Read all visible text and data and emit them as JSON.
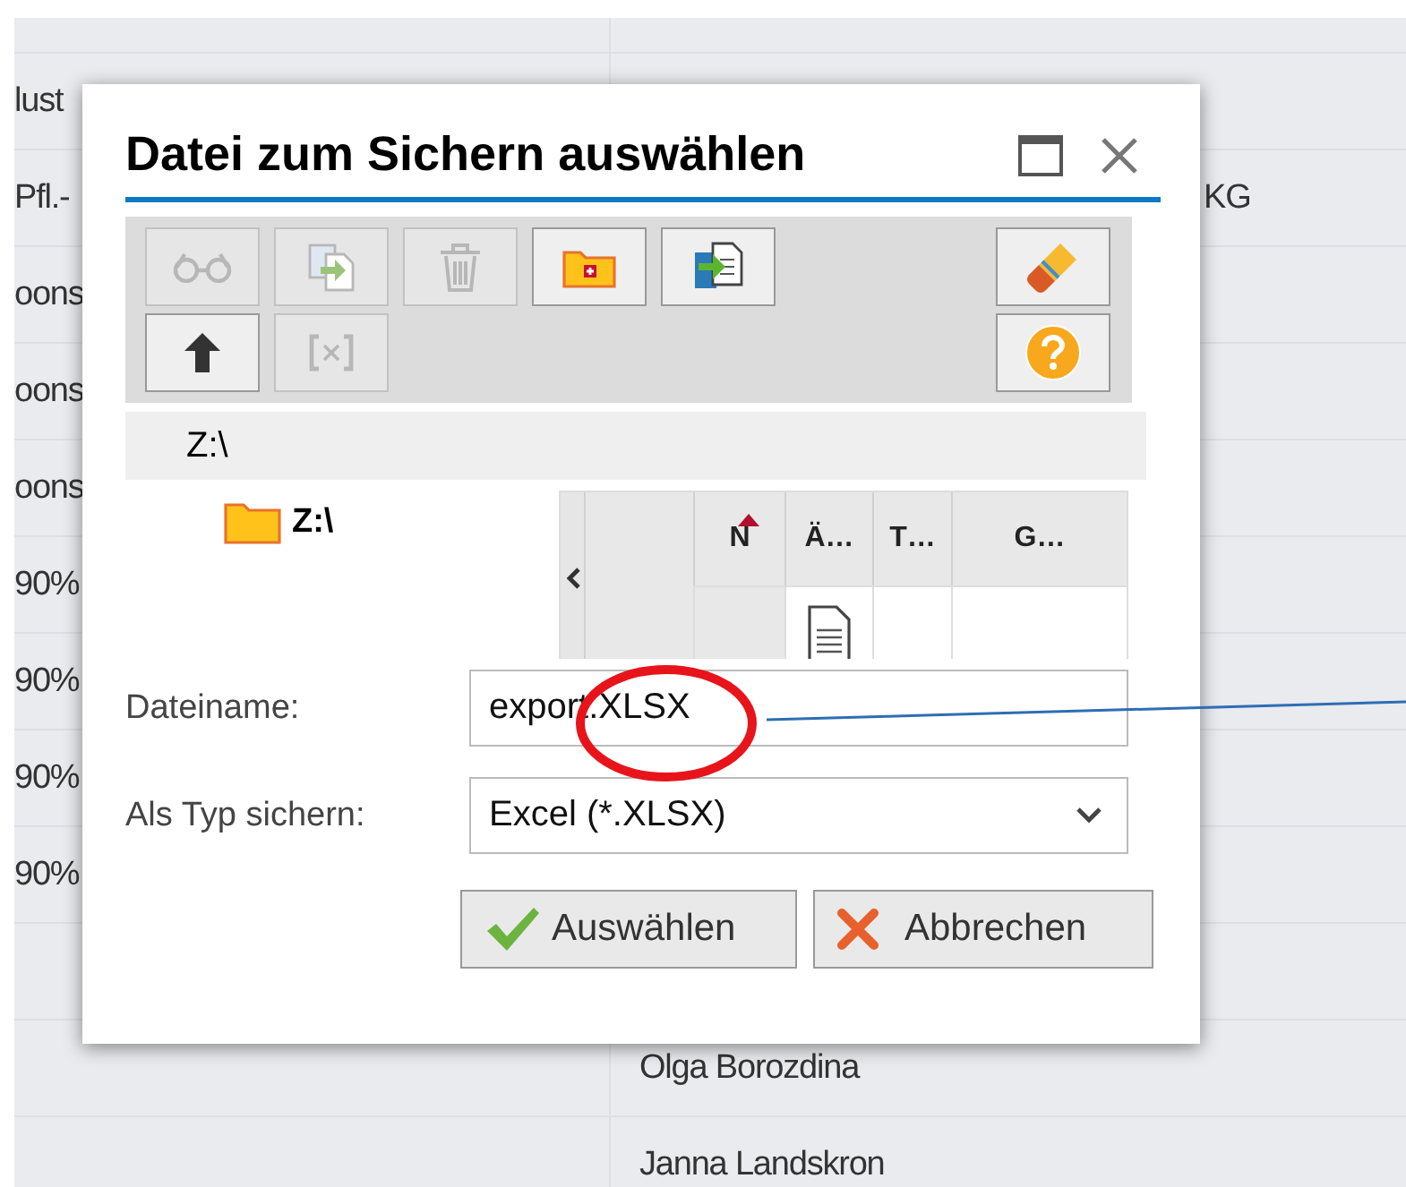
{
  "background_table": {
    "rows": [
      {},
      {
        "column_1": "lust"
      },
      {
        "column_1": "Pfl.-",
        "column_2_visible_end": "KG"
      },
      {
        "column_1": "oons"
      },
      {
        "column_1": "oons"
      },
      {
        "column_1": "oons"
      },
      {
        "column_1": "90%"
      },
      {
        "column_1": "90%"
      },
      {
        "column_1": "90%"
      },
      {
        "column_1": "90%"
      },
      {},
      {
        "column_2": "Olga Borozdina"
      },
      {
        "column_2": "Janna Landskron"
      }
    ]
  },
  "dialog": {
    "title": "Datei zum Sichern auswählen",
    "toolbar": {
      "rows": [
        {
          "left": [
            {
              "kind": "view",
              "disabled": true
            },
            {
              "kind": "copy",
              "disabled": true
            },
            {
              "kind": "delete",
              "disabled": true
            },
            {
              "kind": "new-folder",
              "disabled": false
            },
            {
              "kind": "import",
              "disabled": false
            }
          ],
          "right": [
            {
              "kind": "eraser",
              "disabled": false
            }
          ]
        },
        {
          "left": [
            {
              "kind": "up",
              "disabled": false
            },
            {
              "kind": "brackets",
              "disabled": true
            }
          ],
          "right": [
            {
              "kind": "help",
              "disabled": false
            }
          ]
        }
      ]
    },
    "path": "Z:\\",
    "tree": [
      {
        "label": "Z:\\"
      }
    ],
    "file_table": {
      "columns": [
        {
          "label": "N",
          "sorted": true
        },
        {
          "label": "Ä…",
          "sorted": false
        },
        {
          "label": "T…",
          "sorted": false
        },
        {
          "label": "G…",
          "sorted": false
        }
      ]
    },
    "fields": [
      {
        "kind": "text",
        "label": "Dateiname:",
        "value": "export.XLSX"
      },
      {
        "kind": "select",
        "label": "Als Typ sichern:",
        "value": "Excel (*.XLSX)"
      }
    ],
    "buttons": [
      {
        "kind": "ok",
        "label": "Auswählen"
      },
      {
        "kind": "cancel",
        "label": "Abbrechen"
      }
    ]
  },
  "annotations": [
    {
      "kind": "ellipse",
      "color": "#e8141b"
    },
    {
      "kind": "line",
      "color": "#2e6db4"
    }
  ]
}
